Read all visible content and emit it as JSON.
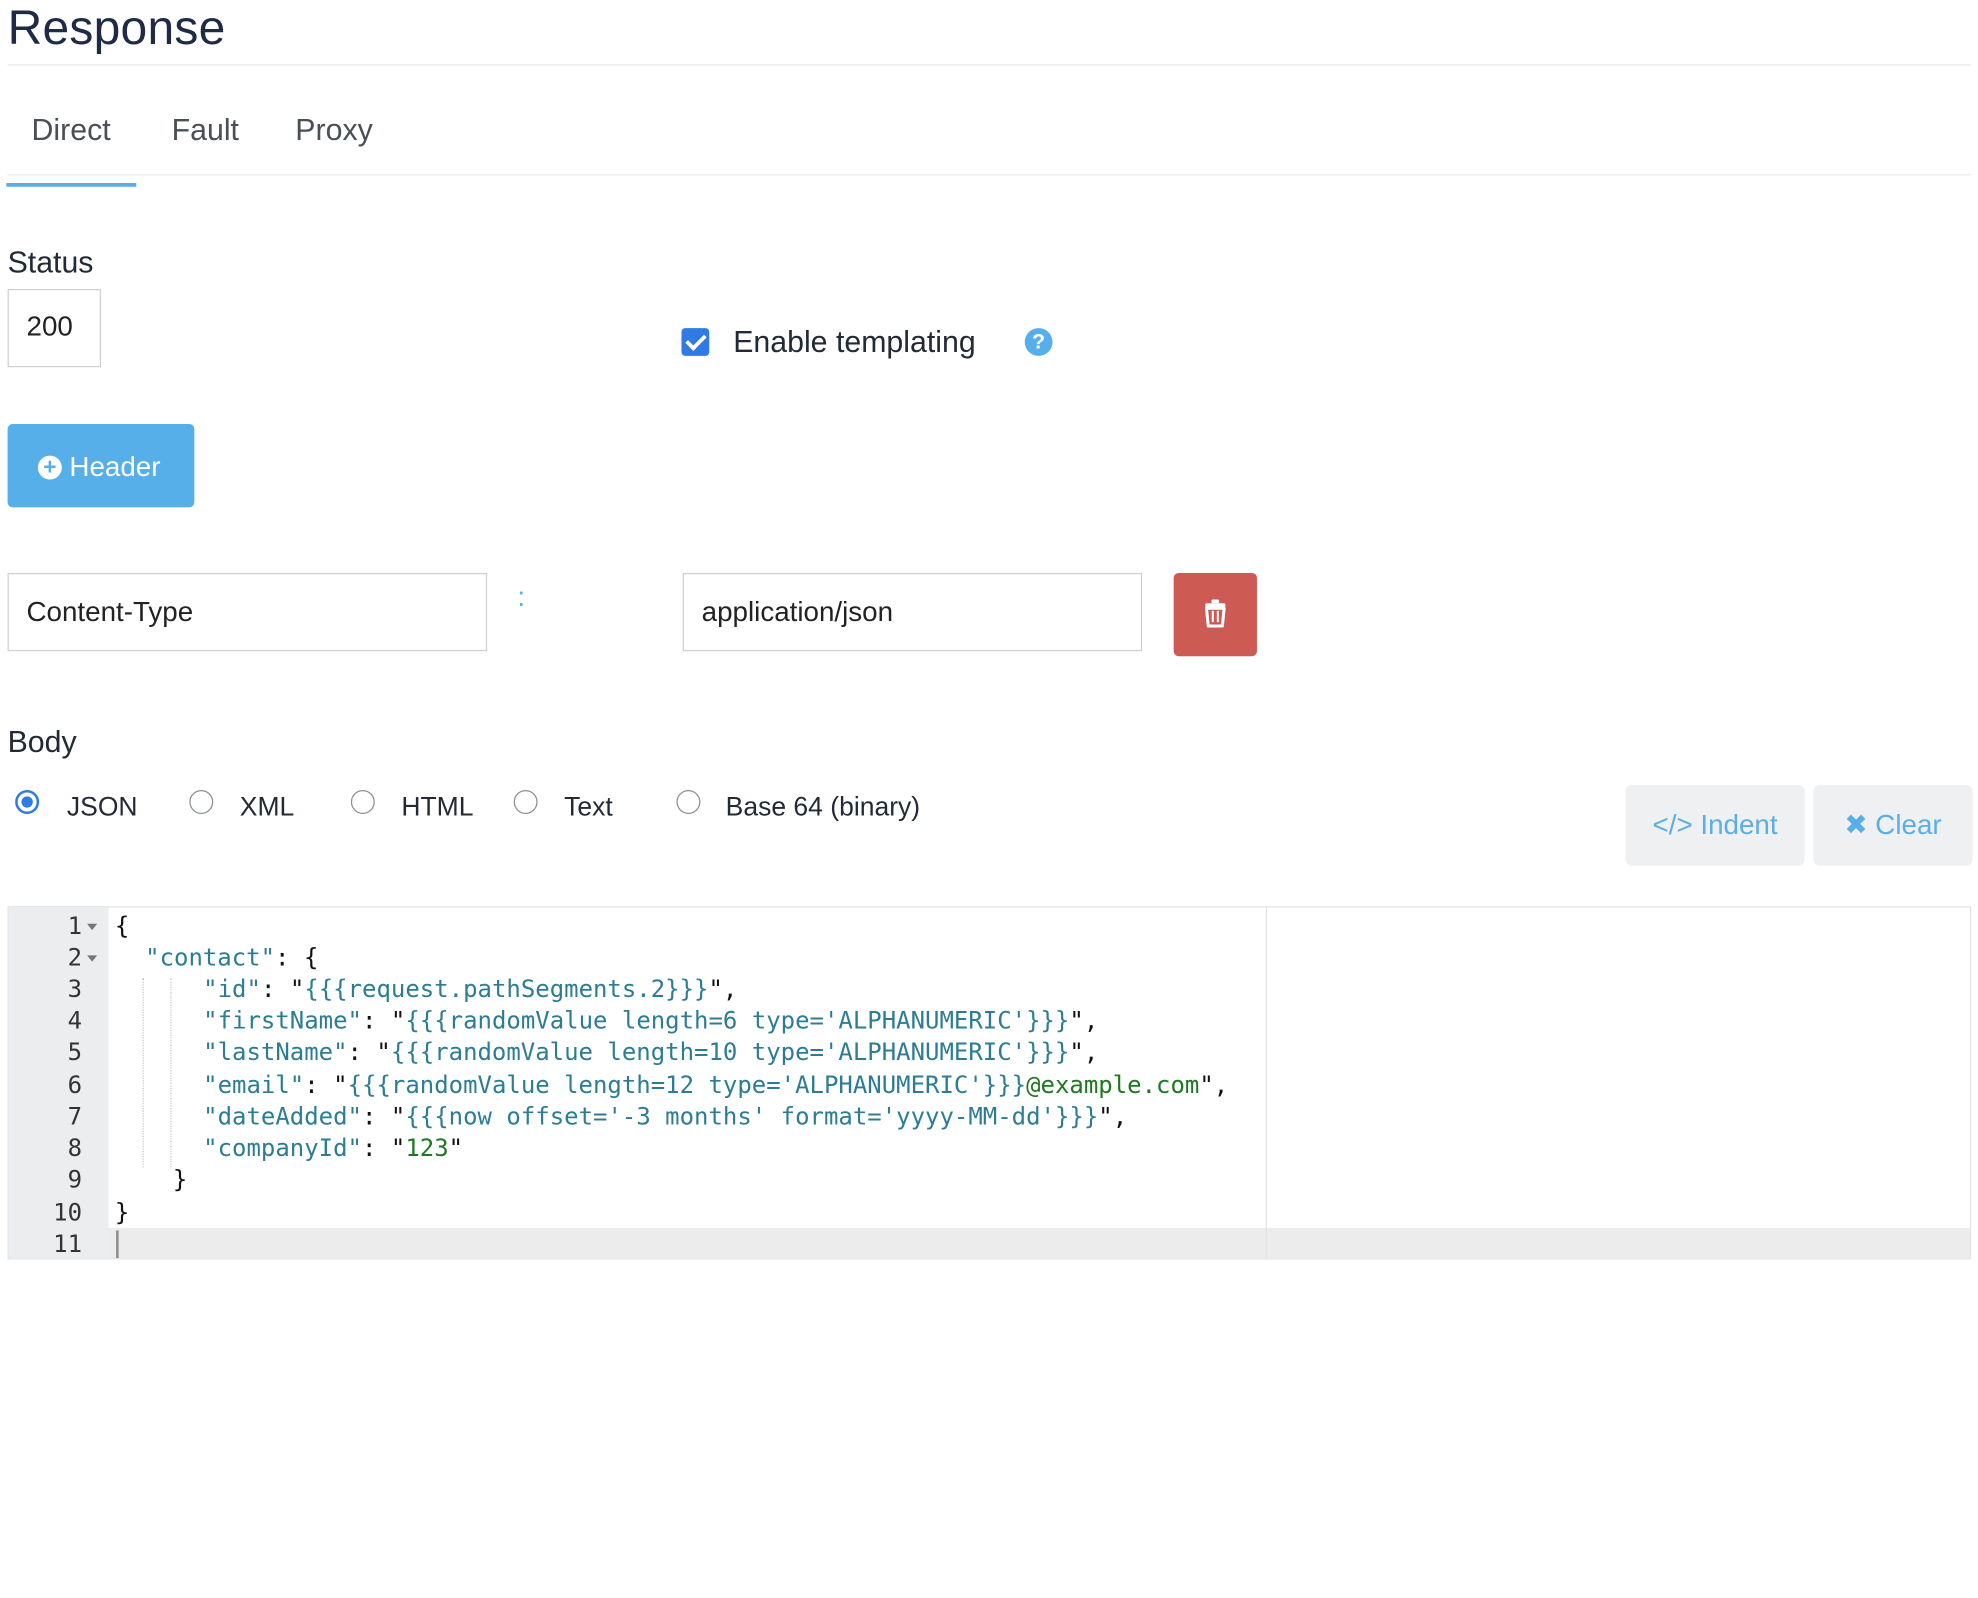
{
  "page": {
    "title": "Response"
  },
  "tabs": [
    {
      "label": "Direct",
      "active": true
    },
    {
      "label": "Fault",
      "active": false
    },
    {
      "label": "Proxy",
      "active": false
    }
  ],
  "status": {
    "label": "Status",
    "value": "200"
  },
  "templating": {
    "label": "Enable templating",
    "checked": true,
    "help_icon": "question-circle-icon"
  },
  "header_button": {
    "label": "Header",
    "icon": "plus-circle-icon"
  },
  "headers": [
    {
      "name": "Content-Type",
      "separator": ":",
      "value": "application/json",
      "delete_icon": "trash-icon"
    }
  ],
  "body": {
    "label": "Body",
    "formats": [
      {
        "label": "JSON",
        "selected": true
      },
      {
        "label": "XML",
        "selected": false
      },
      {
        "label": "HTML",
        "selected": false
      },
      {
        "label": "Text",
        "selected": false
      },
      {
        "label": "Base 64 (binary)",
        "selected": false
      }
    ],
    "indent_label": "</> Indent",
    "clear_label": "✖ Clear"
  },
  "editor": {
    "line_numbers": [
      "1",
      "2",
      "3",
      "4",
      "5",
      "6",
      "7",
      "8",
      "9",
      "10",
      "11"
    ],
    "lines": [
      "{",
      "  \"contact\": {",
      "    \"id\": \"{{{request.pathSegments.2}}}\",",
      "    \"firstName\": \"{{{randomValue length=6 type='ALPHANUMERIC'}}}\",",
      "    \"lastName\": \"{{{randomValue length=10 type='ALPHANUMERIC'}}}\",",
      "    \"email\": \"{{{randomValue length=12 type='ALPHANUMERIC'}}}@example.com\",",
      "    \"dateAdded\": \"{{{now offset='-3 months' format='yyyy-MM-dd'}}}\",",
      "    \"companyId\": \"123\"",
      "  }",
      "}",
      ""
    ]
  },
  "colors": {
    "accent": "#57afe9",
    "checkbox": "#2f7ae5",
    "danger": "#cd5a53",
    "json_key": "#2c7d93",
    "json_string": "#207722"
  }
}
